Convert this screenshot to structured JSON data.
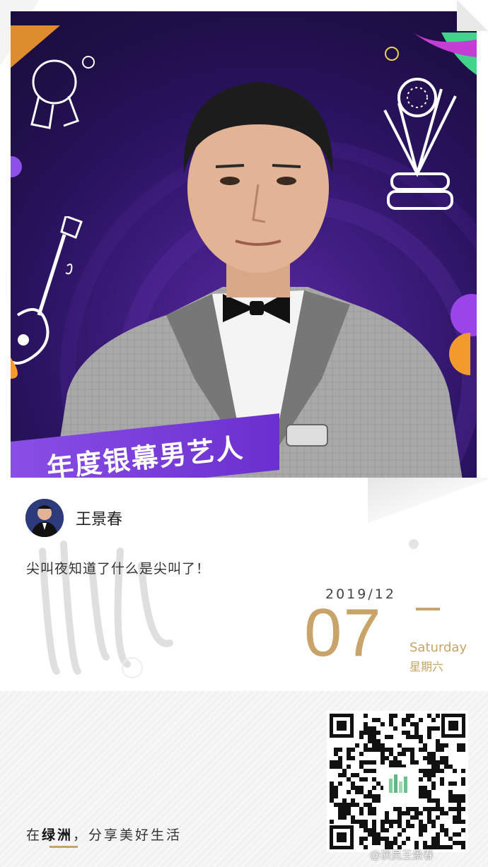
{
  "banner": {
    "text": "年度银幕男艺人"
  },
  "author": {
    "name": "王景春"
  },
  "post": {
    "text": "尖叫夜知道了什么是尖叫了！"
  },
  "date": {
    "year_month": "2019/12",
    "day": "07",
    "weekday_en": "Saturday",
    "weekday_cn": "星期六"
  },
  "footer": {
    "slogan_prefix": "在",
    "slogan_highlight": "绿洲",
    "slogan_suffix": "，分享美好生活"
  },
  "watermark": {
    "text": "@演员王景春"
  },
  "colors": {
    "accent_gold": "#c8a46a",
    "banner_purple": "#7a3fdc",
    "bg_purple": "#24114f"
  }
}
